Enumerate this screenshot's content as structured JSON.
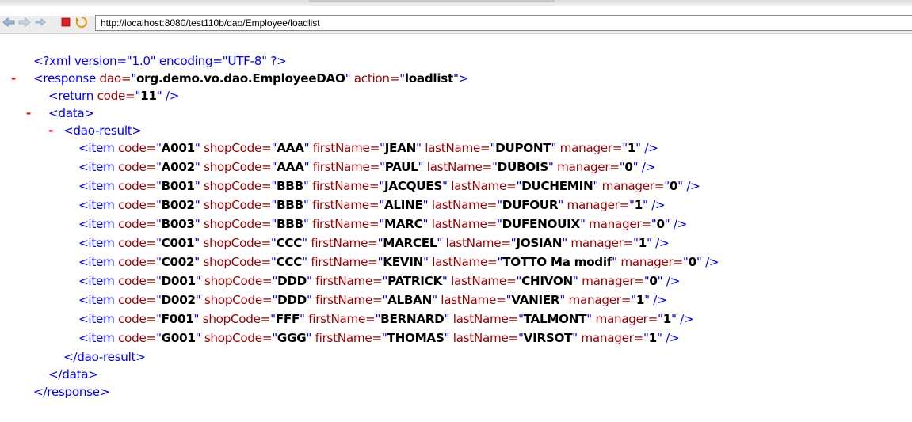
{
  "browser": {
    "url": "http://localhost:8080/test110b/dao/Employee/loadlist",
    "buttons": {
      "back": "back-arrow-icon",
      "forward": "forward-arrow-icon",
      "stop": "stop-icon",
      "reload": "reload-icon"
    }
  },
  "xml": {
    "declaration": "<?xml version=\"1.0\" encoding=\"UTF-8\" ?>",
    "response": {
      "dao": "org.demo.vo.dao.EmployeeDAO",
      "action": "loadlist"
    },
    "return_code": "11",
    "items": [
      {
        "code": "A001",
        "shopCode": "AAA",
        "firstName": "JEAN",
        "lastName": "DUPONT",
        "manager": "1"
      },
      {
        "code": "A002",
        "shopCode": "AAA",
        "firstName": "PAUL",
        "lastName": "DUBOIS",
        "manager": "0"
      },
      {
        "code": "B001",
        "shopCode": "BBB",
        "firstName": "JACQUES",
        "lastName": "DUCHEMIN",
        "manager": "0"
      },
      {
        "code": "B002",
        "shopCode": "BBB",
        "firstName": "ALINE",
        "lastName": "DUFOUR",
        "manager": "1"
      },
      {
        "code": "B003",
        "shopCode": "BBB",
        "firstName": "MARC",
        "lastName": "DUFENOUIX",
        "manager": "0"
      },
      {
        "code": "C001",
        "shopCode": "CCC",
        "firstName": "MARCEL",
        "lastName": "JOSIAN",
        "manager": "1"
      },
      {
        "code": "C002",
        "shopCode": "CCC",
        "firstName": "KEVIN",
        "lastName": "TOTTO Ma modif",
        "manager": "0"
      },
      {
        "code": "D001",
        "shopCode": "DDD",
        "firstName": "PATRICK",
        "lastName": "CHIVON",
        "manager": "0"
      },
      {
        "code": "D002",
        "shopCode": "DDD",
        "firstName": "ALBAN",
        "lastName": "VANIER",
        "manager": "1"
      },
      {
        "code": "F001",
        "shopCode": "FFF",
        "firstName": "BERNARD",
        "lastName": "TALMONT",
        "manager": "1"
      },
      {
        "code": "G001",
        "shopCode": "GGG",
        "firstName": "THOMAS",
        "lastName": "VIRSOT",
        "manager": "1"
      }
    ]
  },
  "colors": {
    "tag": "#0000ff",
    "attribute": "#990000",
    "value": "#000000",
    "collapse_marker": "#ff0000"
  }
}
